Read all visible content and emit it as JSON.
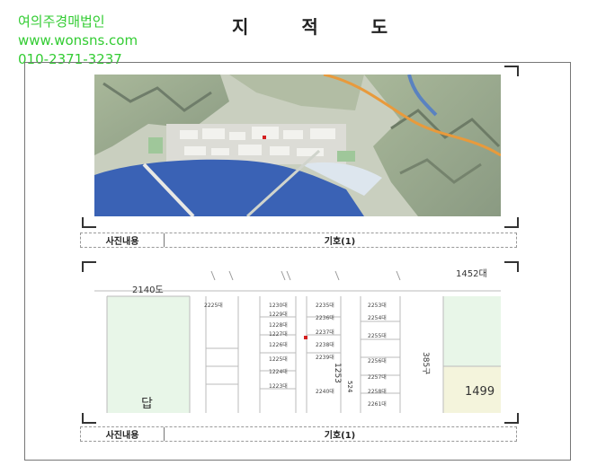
{
  "watermark": {
    "company": "여의주경매법인",
    "website": "www.wonsns.com",
    "phone": "010-2371-3237"
  },
  "title": "지 적 도",
  "photo_caption": {
    "left": "사진내용",
    "right": "기호(1)"
  },
  "map_caption": {
    "left": "사진내용",
    "right": "기호(1)"
  },
  "map_labels": {
    "road_label": "2140도",
    "top_right": "1452대",
    "left_bottom": "답",
    "right_bottom": "1499",
    "vertical_mid": "1253",
    "vertical_right": "385구",
    "vertical_center": "524",
    "parcels_col1": [
      "2225대"
    ],
    "parcels_col2": [
      "1230대",
      "1229대",
      "1228대",
      "1227대",
      "1226대",
      "1225대",
      "1224대",
      "1223대"
    ],
    "parcels_col3": [
      "2235대",
      "2236대",
      "2237대",
      "2238대",
      "2239대",
      "2240대"
    ],
    "parcels_col4": [
      "2253대",
      "2254대",
      "2255대",
      "2256대",
      "2257대",
      "2258대",
      "2261대"
    ]
  },
  "colors": {
    "watermark": "#33cc33",
    "green_zone": "#e8f6e8"
  }
}
